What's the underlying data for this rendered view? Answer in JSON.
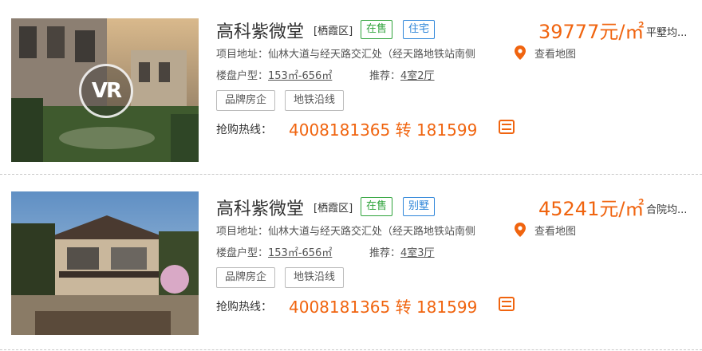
{
  "listings": [
    {
      "title": "高科紫微堂",
      "district": "[栖霞区]",
      "status_tag": "在售",
      "type_tag": "住宅",
      "price": "39777元/㎡",
      "price_note": "平墅均...",
      "address_label": "项目地址：",
      "address": "仙林大道与经天路交汇处（经天路地铁站南侧",
      "map_link": "查看地图",
      "layout_label": "楼盘户型：",
      "layout_value": "153㎡-656㎡",
      "recommend_label": "推荐：",
      "recommend_value": "4室2厅",
      "features": [
        "品牌房企",
        "地铁沿线"
      ],
      "hotline_label": "抢购热线：",
      "hotline_number": "4008181365 转 181599",
      "vr_badge": "VR",
      "image": "villa-courtyard-photo"
    },
    {
      "title": "高科紫微堂",
      "district": "[栖霞区]",
      "status_tag": "在售",
      "type_tag": "别墅",
      "price": "45241元/㎡",
      "price_note": "合院均...",
      "address_label": "项目地址：",
      "address": "仙林大道与经天路交汇处（经天路地铁站南侧",
      "map_link": "查看地图",
      "layout_label": "楼盘户型：",
      "layout_value": "153㎡-656㎡",
      "recommend_label": "推荐：",
      "recommend_value": "4室3厅",
      "features": [
        "品牌房企",
        "地铁沿线"
      ],
      "hotline_label": "抢购热线：",
      "hotline_number": "4008181365 转 181599",
      "image": "villa-exterior-photo"
    }
  ],
  "colors": {
    "accent": "#f0640f",
    "tag_green": "#2fa33b",
    "tag_blue": "#2f86d9",
    "pin": "#f0640f"
  },
  "icons": {
    "map_pin": "map-pin-icon",
    "phone": "phone-icon"
  }
}
